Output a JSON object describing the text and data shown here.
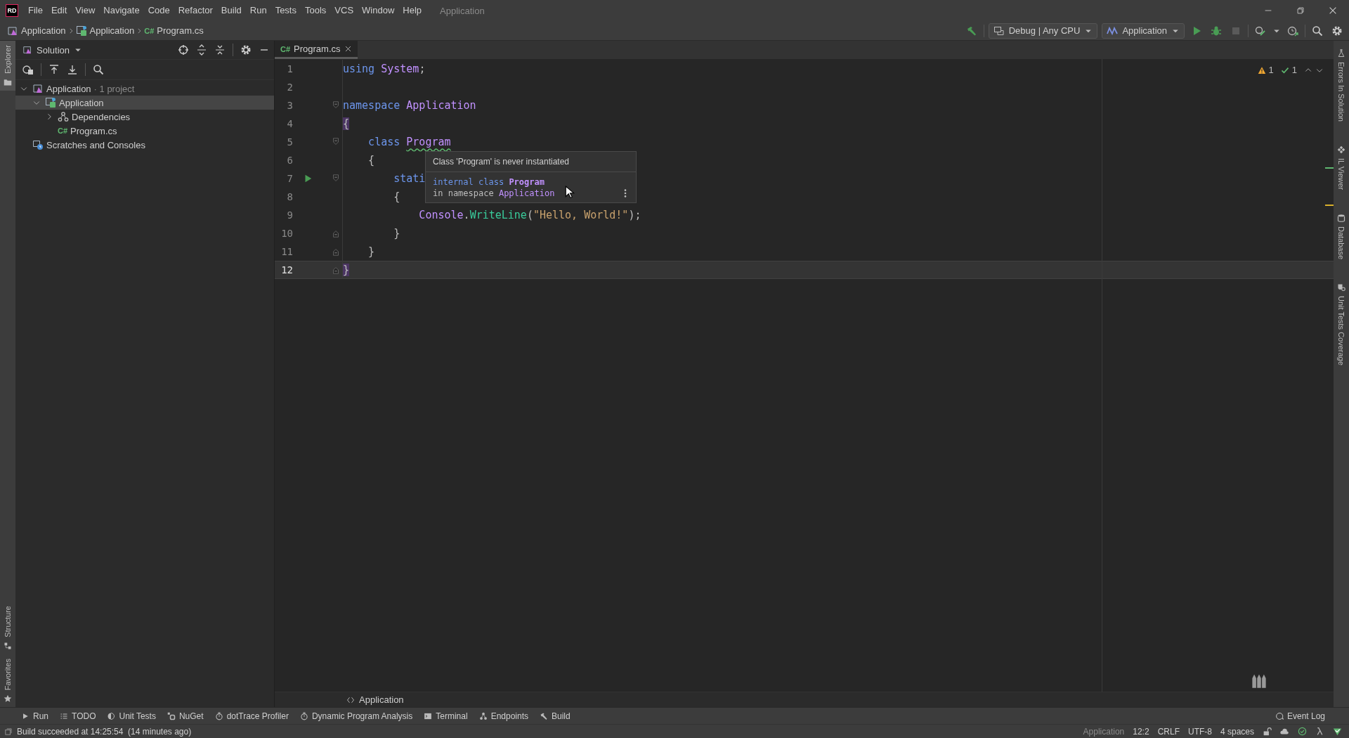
{
  "menu": {
    "logo": "RD",
    "items": [
      "File",
      "Edit",
      "View",
      "Navigate",
      "Code",
      "Refactor",
      "Build",
      "Run",
      "Tests",
      "Tools",
      "VCS",
      "Window",
      "Help"
    ],
    "title": "Application"
  },
  "navbar": {
    "breadcrumbs": [
      {
        "label": "Application",
        "kind": "solution"
      },
      {
        "label": "Application",
        "kind": "project"
      },
      {
        "label": "Program.cs",
        "kind": "file",
        "badge": "C#"
      }
    ],
    "configuration": "Debug | Any CPU",
    "run_target": "Application"
  },
  "left_stripe": {
    "top": [
      {
        "label": "Explorer",
        "kind": "explorer",
        "selected": true
      }
    ],
    "bottom": [
      {
        "label": "Structure",
        "kind": "structure",
        "selected": false
      },
      {
        "label": "Favorites",
        "kind": "favorites",
        "selected": false
      }
    ]
  },
  "right_stripe": [
    {
      "label": "Errors In Solution",
      "kind": "errors"
    },
    {
      "label": "IL Viewer",
      "kind": "il"
    },
    {
      "label": "Database",
      "kind": "database"
    },
    {
      "label": "Unit Tests Coverage",
      "kind": "coverage"
    }
  ],
  "explorer": {
    "view": "Solution",
    "tree": [
      {
        "label": "Application",
        "note": "· 1 project",
        "kind": "solution",
        "expanded": true,
        "selected": false,
        "children": [
          {
            "label": "Application",
            "kind": "project",
            "expanded": true,
            "selected": true,
            "children": [
              {
                "label": "Dependencies",
                "kind": "dependencies",
                "expanded": false,
                "selected": false
              },
              {
                "label": "Program.cs",
                "kind": "file",
                "badge": "C#",
                "selected": false
              }
            ]
          }
        ]
      },
      {
        "label": "Scratches and Consoles",
        "kind": "scratches",
        "selected": false
      }
    ]
  },
  "editor": {
    "tabs": [
      {
        "badge": "C#",
        "label": "Program.cs",
        "selected": true
      }
    ],
    "inspections": {
      "warnings": "1",
      "passed": "1"
    },
    "lines": [
      {
        "number": "1",
        "kind": "plain",
        "run_marker": false,
        "current": false,
        "tokens": [
          {
            "text": "using ",
            "kind": "keyword"
          },
          {
            "text": "System",
            "kind": "identifier"
          },
          {
            "text": ";",
            "kind": "plain"
          }
        ]
      },
      {
        "number": "2",
        "kind": "plain",
        "run_marker": false,
        "current": false
      },
      {
        "number": "3",
        "kind": "fold-start",
        "run_marker": false,
        "current": false,
        "tokens": [
          {
            "text": "namespace ",
            "kind": "keyword"
          },
          {
            "text": "Application",
            "kind": "identifier"
          }
        ]
      },
      {
        "number": "4",
        "kind": "plain",
        "run_marker": false,
        "current": false,
        "tokens": [
          {
            "text": "{",
            "kind": "brace-match"
          }
        ]
      },
      {
        "number": "5",
        "kind": "fold-start",
        "run_marker": false,
        "current": false,
        "tokens": [
          {
            "text": "    class ",
            "kind": "keyword"
          },
          {
            "text": "Program",
            "kind": "identifier-warning"
          }
        ]
      },
      {
        "number": "6",
        "kind": "plain",
        "run_marker": false,
        "current": false,
        "tokens": [
          {
            "text": "    {",
            "kind": "plain"
          }
        ]
      },
      {
        "number": "7",
        "kind": "fold-start",
        "run_marker": true,
        "current": false,
        "tokens": [
          {
            "text": "        stati",
            "kind": "keyword"
          }
        ]
      },
      {
        "number": "8",
        "kind": "plain",
        "run_marker": false,
        "current": false,
        "tokens": [
          {
            "text": "        {",
            "kind": "plain"
          }
        ]
      },
      {
        "number": "9",
        "kind": "plain",
        "run_marker": false,
        "current": false,
        "tokens": [
          {
            "text": "            Console",
            "kind": "identifier"
          },
          {
            "text": ".",
            "kind": "plain"
          },
          {
            "text": "WriteLine",
            "kind": "method"
          },
          {
            "text": "(",
            "kind": "plain"
          },
          {
            "text": "\"Hello, World!\"",
            "kind": "string"
          },
          {
            "text": ");",
            "kind": "plain"
          }
        ]
      },
      {
        "number": "10",
        "kind": "fold-end",
        "run_marker": false,
        "current": false,
        "tokens": [
          {
            "text": "        }",
            "kind": "plain"
          }
        ]
      },
      {
        "number": "11",
        "kind": "fold-end",
        "run_marker": false,
        "current": false,
        "tokens": [
          {
            "text": "    }",
            "kind": "plain"
          }
        ]
      },
      {
        "number": "12",
        "kind": "fold-end",
        "run_marker": false,
        "current": true,
        "tokens": [
          {
            "text": "}",
            "kind": "brace-match"
          }
        ]
      }
    ],
    "tooltip": {
      "message": "Class 'Program' is never instantiated",
      "signature": [
        {
          "text": "internal class ",
          "kind": "keyword"
        },
        {
          "text": "Program",
          "kind": "identifier-bold"
        }
      ],
      "location": [
        {
          "text": "in namespace ",
          "kind": "plain"
        },
        {
          "text": "Application",
          "kind": "identifier"
        }
      ]
    },
    "breadcrumb": "Application"
  },
  "tool_windows": [
    {
      "label": "Run",
      "kind": "run"
    },
    {
      "label": "TODO",
      "kind": "todo"
    },
    {
      "label": "Unit Tests",
      "kind": "unit-tests"
    },
    {
      "label": "NuGet",
      "kind": "nuget"
    },
    {
      "label": "dotTrace Profiler",
      "kind": "profiler"
    },
    {
      "label": "Dynamic Program Analysis",
      "kind": "analysis"
    },
    {
      "label": "Terminal",
      "kind": "terminal"
    },
    {
      "label": "Endpoints",
      "kind": "endpoints"
    },
    {
      "label": "Build",
      "kind": "build"
    }
  ],
  "event_log": "Event Log",
  "status": {
    "message": "Build succeeded at 14:25:54  (14 minutes ago)",
    "items": [
      "Application",
      "12:2",
      "CRLF",
      "UTF-8",
      "4 spaces"
    ]
  }
}
